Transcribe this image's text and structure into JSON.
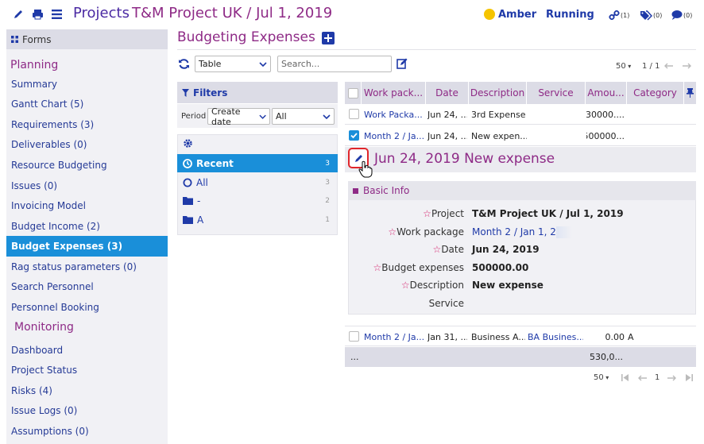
{
  "header": {
    "projects_label": "Projects",
    "project_name": "T&M Project UK / Jul 1, 2019",
    "status_color_label": "Amber",
    "status_color": "#f5c400",
    "run_state": "Running",
    "links_count": "(1)",
    "tags_count": "(0)",
    "comments_count": "(0)"
  },
  "sidebar": {
    "forms_label": "Forms",
    "planning_label": "Planning",
    "monitoring_label": "Monitoring",
    "planning_items": [
      "Summary",
      "Gantt Chart (5)",
      "Requirements (3)",
      "Deliverables (0)",
      "Resource Budgeting",
      "Issues (0)",
      "Invoicing Model",
      "Budget Income (2)",
      "Budget Expenses (3)",
      "Rag status parameters (0)",
      "Search Personnel",
      "Personnel Booking"
    ],
    "monitoring_items": [
      "Dashboard",
      "Project Status",
      "Risks (4)",
      "Issue Logs (0)",
      "Assumptions (0)"
    ]
  },
  "main": {
    "title": "Budgeting Expenses",
    "view_select": "Table",
    "search_placeholder": "Search...",
    "page_size": "50",
    "page_info": "1 / 1"
  },
  "filters": {
    "title": "Filters",
    "period_label": "Period",
    "period_field": "Create date",
    "period_value": "All",
    "items": [
      {
        "label": "Recent",
        "count": "3"
      },
      {
        "label": "All",
        "count": "3"
      },
      {
        "label": "-",
        "count": "2"
      },
      {
        "label": "A",
        "count": "1"
      }
    ]
  },
  "table": {
    "columns": [
      "Work pack...",
      "Date",
      "Description",
      "Service",
      "Amou...",
      "Category"
    ],
    "rows": [
      {
        "work_package": "Work Packa...",
        "date": "Jun 24, ...",
        "description": "3rd Expense",
        "service": "",
        "amount": "30000....",
        "category": ""
      },
      {
        "work_package": "Month 2 / Ja...",
        "date": "Jun 24, ...",
        "description": "New expen...",
        "service": "",
        "amount": "500000...",
        "category": ""
      },
      {
        "work_package": "Month 2 / Ja...",
        "date": "Jan 31, ...",
        "description": "Business A...",
        "service": "BA Busines...",
        "amount": "0.00",
        "category": "A"
      }
    ],
    "totals_label": "...",
    "totals_amount": "530,0...",
    "bottom_page_size": "50",
    "bottom_page_num": "1"
  },
  "detail": {
    "title": "Jun 24, 2019 New expense",
    "section_title": "Basic Info",
    "fields": [
      {
        "label": "Project",
        "value": "T&M Project UK / Jul 1, 2019"
      },
      {
        "label": "Work package",
        "value": "Month 2 / Jan 1, 20"
      },
      {
        "label": "Date",
        "value": "Jun 24, 2019"
      },
      {
        "label": "Budget expenses",
        "value": "500000.00"
      },
      {
        "label": "Description",
        "value": "New expense"
      },
      {
        "label": "Service",
        "value": ""
      }
    ]
  }
}
